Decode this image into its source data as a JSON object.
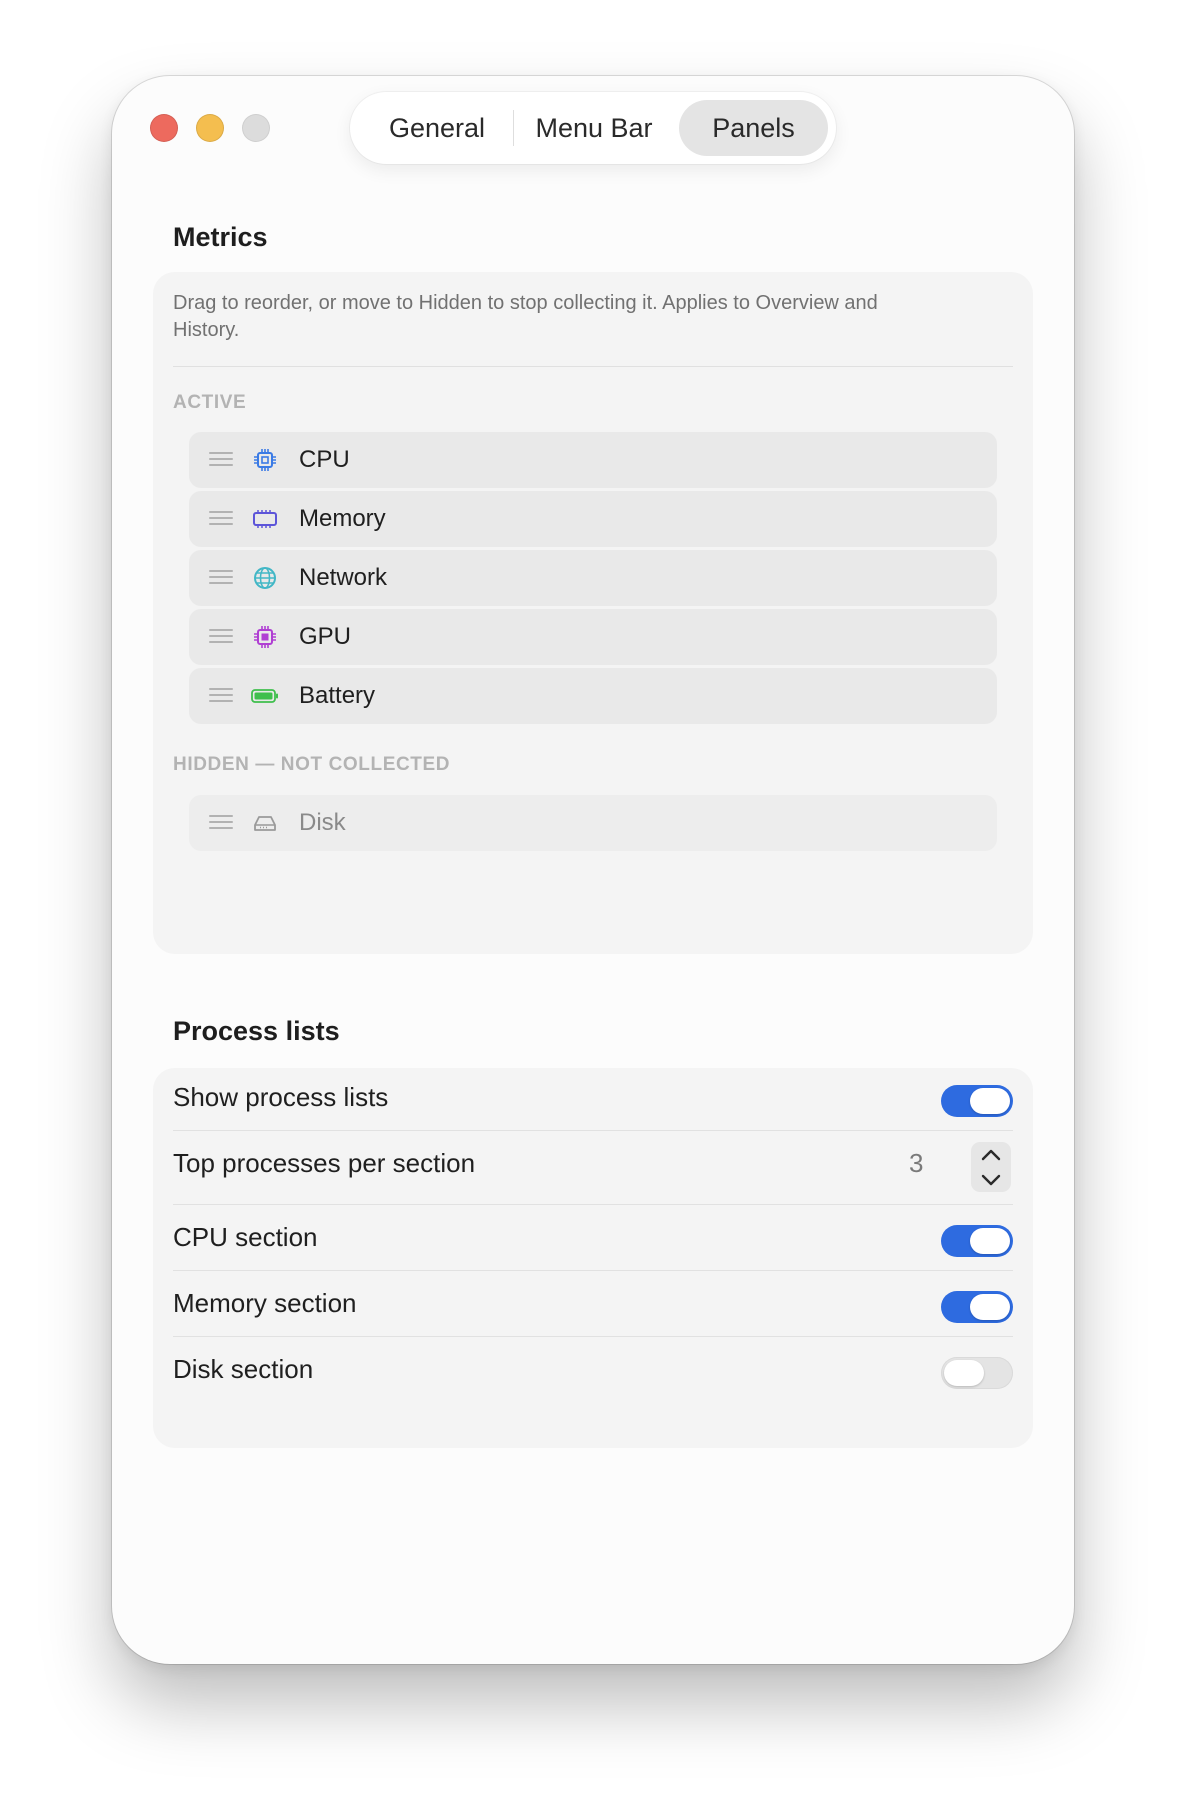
{
  "tabs": {
    "general": "General",
    "menu_bar": "Menu Bar",
    "panels": "Panels",
    "selected": "Panels"
  },
  "metrics": {
    "title": "Metrics",
    "help": "Drag to reorder, or move to Hidden to stop collecting it. Applies to Overview and History.",
    "active_label": "ACTIVE",
    "hidden_label": "HIDDEN — NOT COLLECTED",
    "active": [
      {
        "label": "CPU",
        "icon": "cpu-chip-icon",
        "color": "#3b7be5"
      },
      {
        "label": "Memory",
        "icon": "memory-icon",
        "color": "#5d55d9"
      },
      {
        "label": "Network",
        "icon": "globe-icon",
        "color": "#42b7c6"
      },
      {
        "label": "GPU",
        "icon": "gpu-chip-icon",
        "color": "#b03fd3"
      },
      {
        "label": "Battery",
        "icon": "battery-icon",
        "color": "#3fbf4d"
      }
    ],
    "hidden": [
      {
        "label": "Disk",
        "icon": "disk-drive-icon",
        "color": "#9a9a9a"
      }
    ]
  },
  "process_lists": {
    "title": "Process lists",
    "show": {
      "label": "Show process lists",
      "enabled": true
    },
    "top": {
      "label": "Top processes per section",
      "value": "3"
    },
    "cpu": {
      "label": "CPU section",
      "enabled": true
    },
    "memory": {
      "label": "Memory section",
      "enabled": true
    },
    "disk": {
      "label": "Disk section",
      "enabled": false
    }
  },
  "colors": {
    "accent": "#2e6be0",
    "close": "#ed6a5e",
    "minimize": "#f4be4f",
    "zoom": "#dcdcdc"
  }
}
